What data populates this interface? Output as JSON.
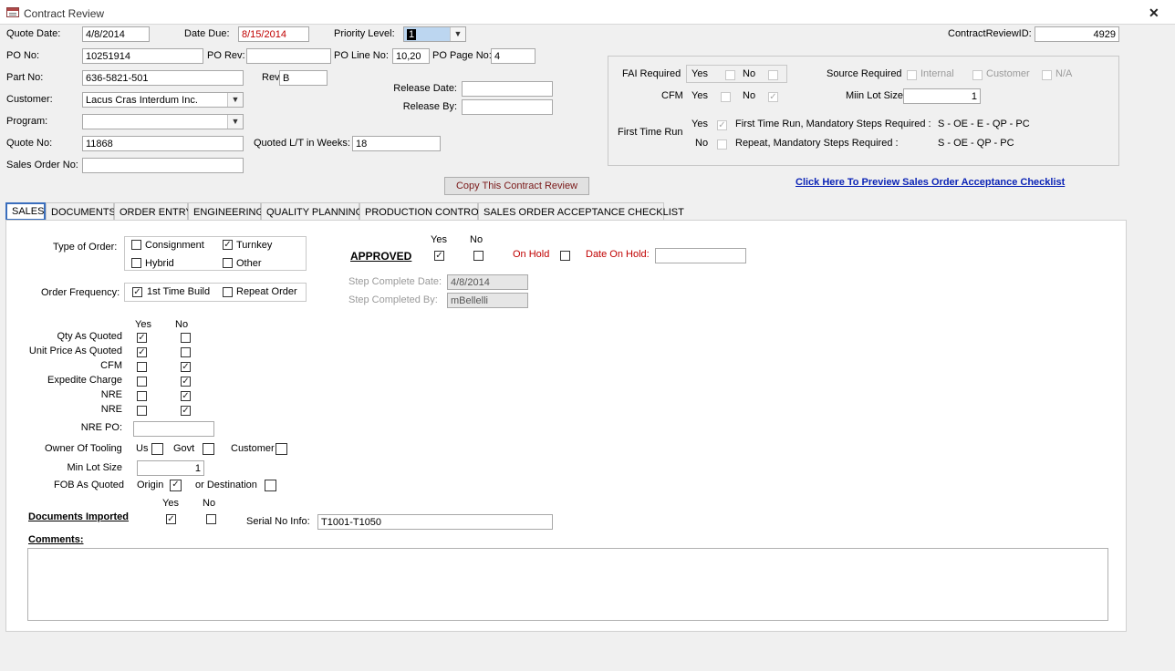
{
  "window": {
    "title": "Contract Review",
    "close": "✕"
  },
  "header": {
    "quote_date": {
      "label": "Quote Date:",
      "value": "4/8/2014"
    },
    "date_due": {
      "label": "Date Due:",
      "value": "8/15/2014"
    },
    "priority_level": {
      "label": "Priority Level:",
      "value": "1"
    },
    "contract_review_id": {
      "label": "ContractReviewID:",
      "value": "4929"
    },
    "po_no": {
      "label": "PO No:",
      "value": "10251914"
    },
    "po_rev": {
      "label": "PO Rev:",
      "value": ""
    },
    "po_line_no": {
      "label": "PO Line No:",
      "value": "10,20"
    },
    "po_page_no": {
      "label": "PO Page No:",
      "value": "4"
    },
    "part_no": {
      "label": "Part No:",
      "value": "636-5821-501"
    },
    "rev": {
      "label": "Rev:",
      "value": "B"
    },
    "release_date": {
      "label": "Release Date:",
      "value": ""
    },
    "release_by": {
      "label": "Release By:",
      "value": ""
    },
    "customer": {
      "label": "Customer:",
      "value": "Lacus Cras Interdum Inc."
    },
    "program": {
      "label": "Program:",
      "value": ""
    },
    "quote_no": {
      "label": "Quote No:",
      "value": "11868"
    },
    "quoted_lt": {
      "label": "Quoted L/T in Weeks:",
      "value": "18"
    },
    "sales_order_no": {
      "label": "Sales Order No:",
      "value": ""
    }
  },
  "info_box": {
    "fai_required": "FAI Required",
    "yes": "Yes",
    "no": "No",
    "cfm": "CFM",
    "source_required": "Source Required",
    "internal": "Internal",
    "customer": "Customer",
    "na": "N/A",
    "min_lot_size_label": "Miin Lot Size",
    "min_lot_size_value": "1",
    "first_time_run": "First Time Run",
    "ftr_text": "First Time Run, Mandatory Steps Required :",
    "ftr_steps": "S  -  OE   -  E  -  QP - PC",
    "repeat_text": "Repeat, Mandatory Steps Required :",
    "repeat_steps": "S  -  OE   -  QP - PC"
  },
  "copy_button": "Copy This Contract Review",
  "preview_link": "Click Here To Preview Sales Order Acceptance Checklist",
  "tabs": [
    "SALES",
    "DOCUMENTS",
    "ORDER ENTRY",
    "ENGINEERING",
    "QUALITY PLANNING",
    "PRODUCTION CONTROL",
    "SALES ORDER ACCEPTANCE CHECKLIST"
  ],
  "sales": {
    "type_of_order": "Type of Order:",
    "consignment": "Consignment",
    "turnkey": "Turnkey",
    "hybrid": "Hybrid",
    "other": "Other",
    "order_frequency": "Order Frequency:",
    "first_time_build": "1st Time Build",
    "repeat_order": "Repeat Order",
    "approved": "APPROVED",
    "yes": "Yes",
    "no": "No",
    "on_hold": "On Hold",
    "date_on_hold": "Date On Hold:",
    "step_complete_date": {
      "label": "Step Complete Date:",
      "value": "4/8/2014"
    },
    "step_completed_by": {
      "label": "Step Completed By:",
      "value": "mBellelli"
    },
    "rows": [
      "Qty As Quoted",
      "Unit Price As Quoted",
      "CFM",
      "Expedite Charge",
      "NRE",
      "NRE"
    ],
    "nre_po": "NRE PO:",
    "owner_of_tooling": "Owner Of Tooling",
    "us": "Us",
    "govt": "Govt",
    "tooling_customer": "Customer",
    "min_lot_size": {
      "label": "Min Lot Size",
      "value": "1"
    },
    "fob_as_quoted": "FOB As Quoted",
    "origin": "Origin",
    "or_destination": "or Destination",
    "documents_imported": "Documents Imported",
    "serial_no_info": {
      "label": "Serial No Info:",
      "value": "T1001-T1050"
    },
    "comments": "Comments:"
  },
  "check_glyph": "✓"
}
